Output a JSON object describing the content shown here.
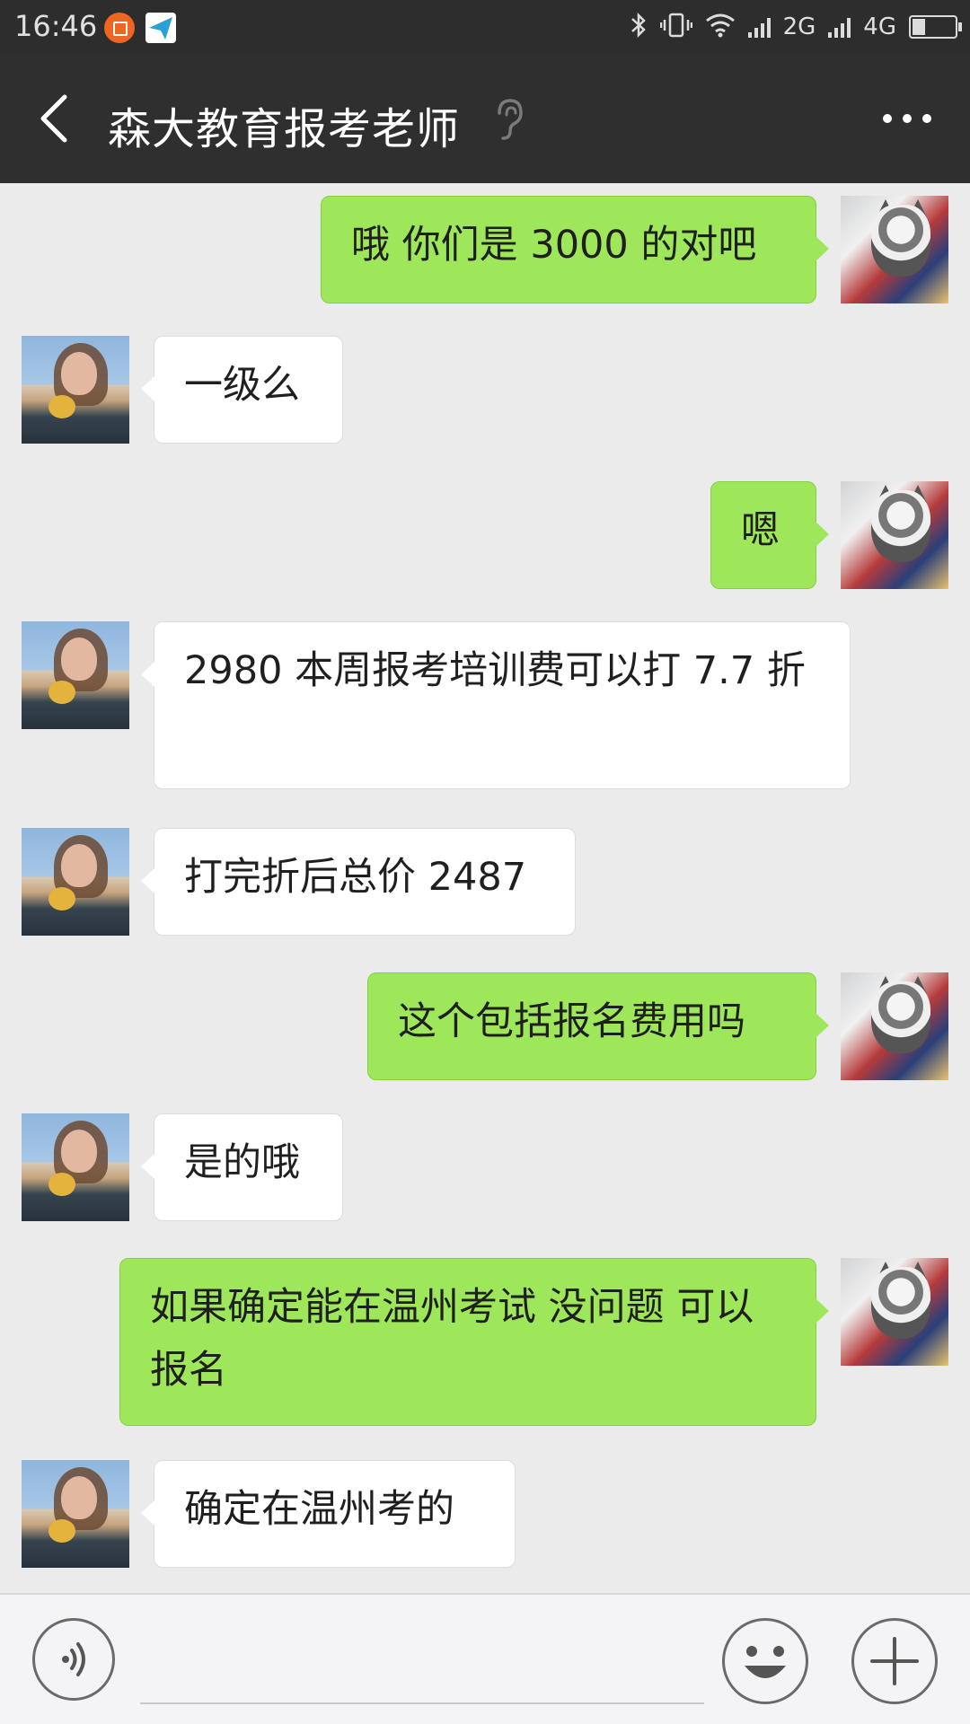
{
  "status_bar": {
    "time": "16:46",
    "network_2g": "2G",
    "network_4g": "4G"
  },
  "header": {
    "title": "森大教育报考老师"
  },
  "messages": [
    {
      "direction": "out",
      "text": "哦  你们是 3000 的对吧"
    },
    {
      "direction": "in",
      "text": "一级么"
    },
    {
      "direction": "out",
      "text": "嗯"
    },
    {
      "direction": "in",
      "text": "2980  本周报考培训费可以打 7.7 折"
    },
    {
      "direction": "in",
      "text": "打完折后总价 2487"
    },
    {
      "direction": "out",
      "text": "这个包括报名费用吗"
    },
    {
      "direction": "in",
      "text": "是的哦"
    },
    {
      "direction": "out",
      "text": "如果确定能在温州考试 没问题 可以报名"
    },
    {
      "direction": "in",
      "text": "确定在温州考的"
    }
  ],
  "input": {
    "placeholder": ""
  },
  "colors": {
    "header_bg": "#2f2f2f",
    "chat_bg": "#ebebeb",
    "outgoing_bubble": "#9fe75a",
    "incoming_bubble": "#ffffff"
  },
  "icons": {
    "back": "chevron-left-icon",
    "voice_mode": "ear-icon",
    "more": "more-dots-icon",
    "voice_input": "voice-icon",
    "emoji": "emoji-icon",
    "plus": "plus-icon"
  }
}
